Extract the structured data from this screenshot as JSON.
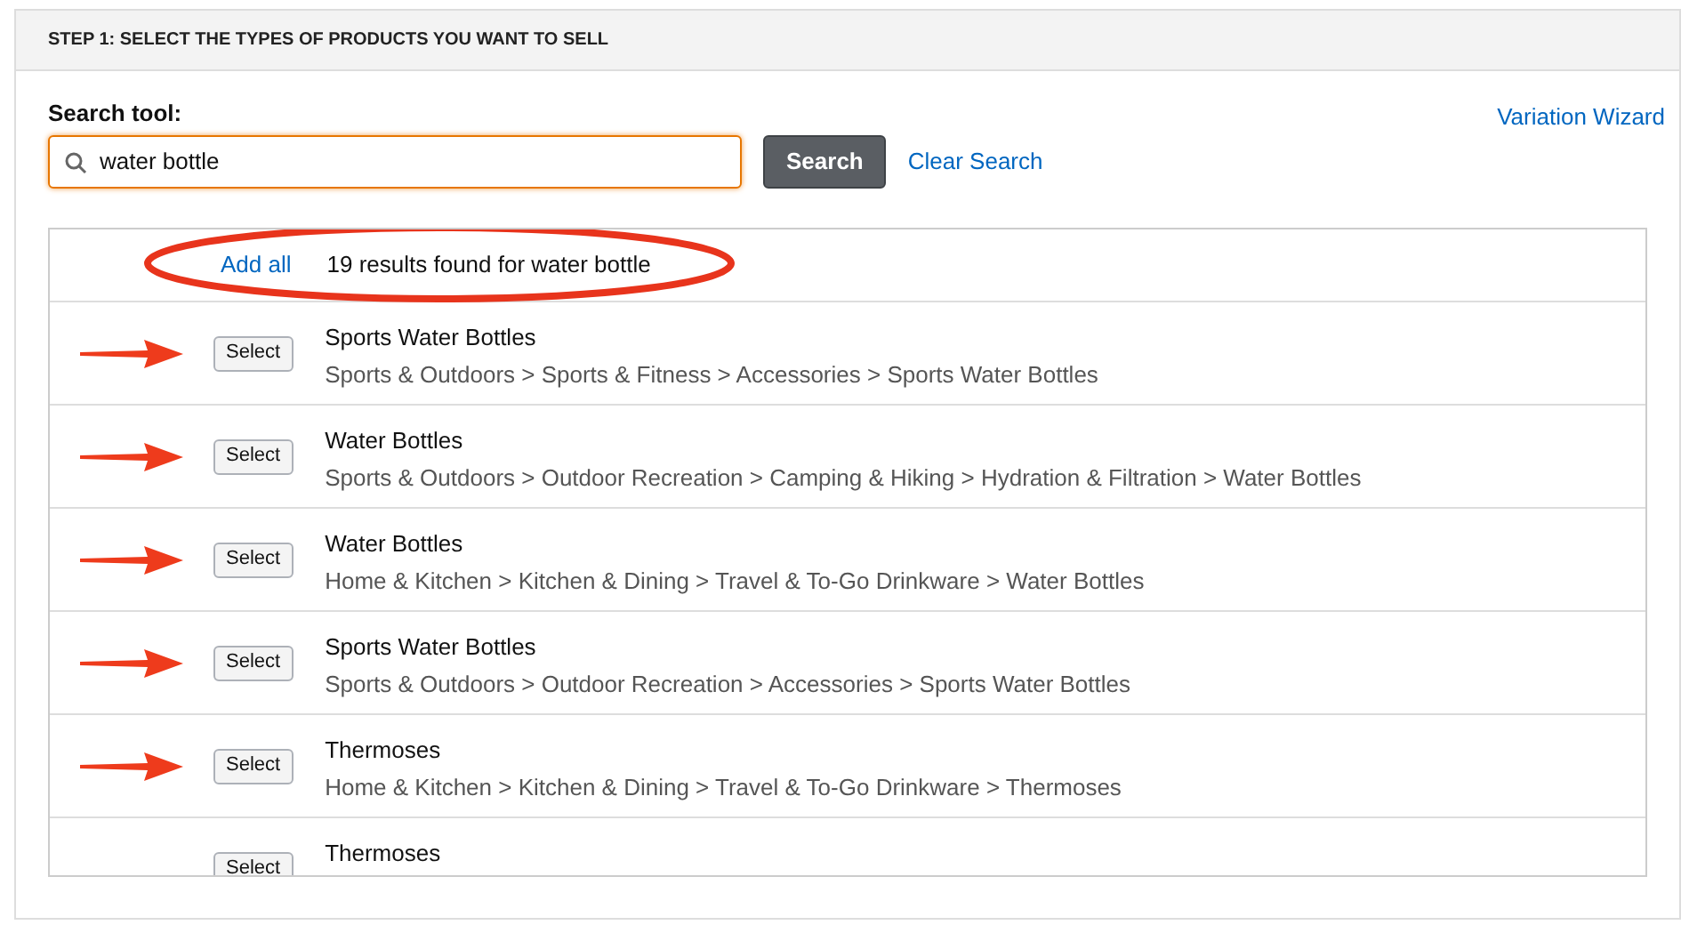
{
  "panel": {
    "title": "STEP 1: SELECT THE TYPES OF PRODUCTS YOU WANT TO SELL"
  },
  "search": {
    "label": "Search tool:",
    "value": "water bottle",
    "button": "Search",
    "clear_link": "Clear Search"
  },
  "variation_link": "Variation Wizard",
  "results": {
    "add_all": "Add all",
    "summary": "19 results found for water bottle",
    "circled": true,
    "rows": [
      {
        "button": "Select",
        "name": "Sports Water Bottles",
        "path": "Sports & Outdoors > Sports & Fitness > Accessories > Sports Water Bottles",
        "arrow": true
      },
      {
        "button": "Select",
        "name": "Water Bottles",
        "path": "Sports & Outdoors > Outdoor Recreation > Camping & Hiking > Hydration & Filtration > Water Bottles",
        "arrow": true
      },
      {
        "button": "Select",
        "name": "Water Bottles",
        "path": "Home & Kitchen > Kitchen & Dining > Travel & To-Go Drinkware > Water Bottles",
        "arrow": true
      },
      {
        "button": "Select",
        "name": "Sports Water Bottles",
        "path": "Sports & Outdoors > Outdoor Recreation > Accessories > Sports Water Bottles",
        "arrow": true
      },
      {
        "button": "Select",
        "name": "Thermoses",
        "path": "Home & Kitchen > Kitchen & Dining > Travel & To-Go Drinkware > Thermoses",
        "arrow": true
      },
      {
        "button": "Select",
        "name": "Thermoses",
        "arrow": false
      }
    ]
  }
}
